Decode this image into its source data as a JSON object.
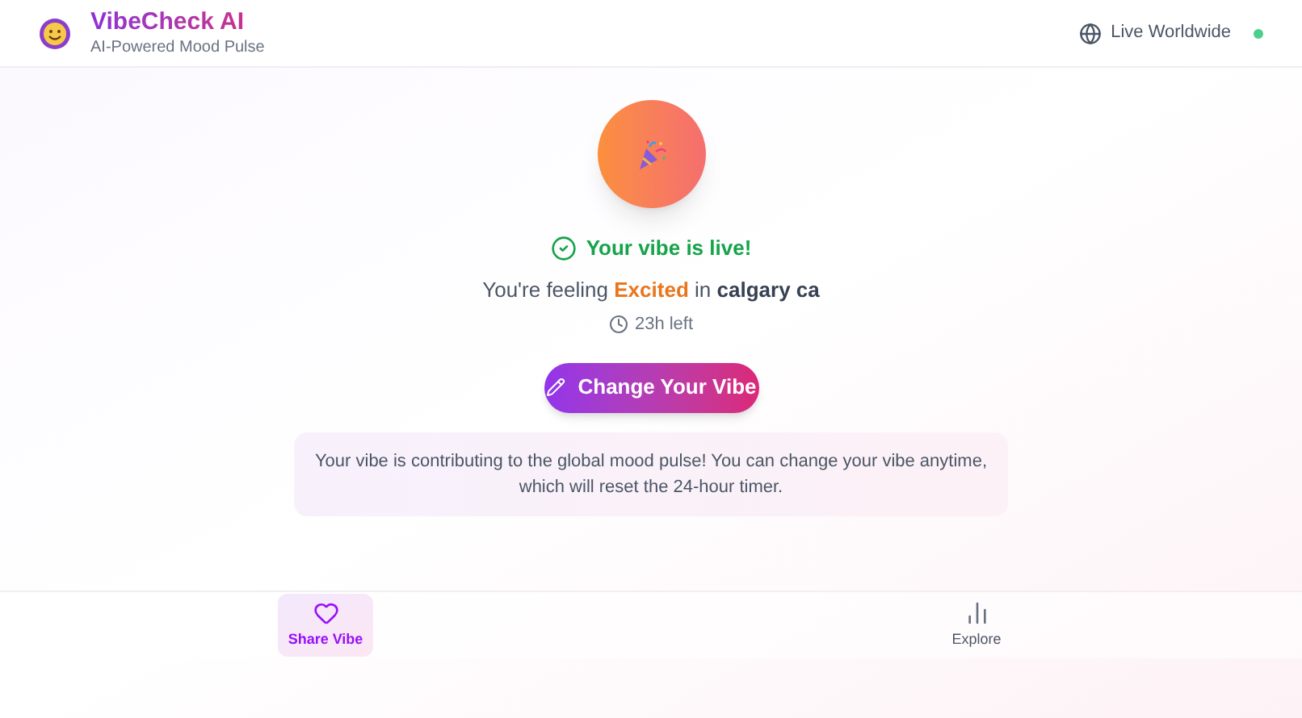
{
  "header": {
    "title": "VibeCheck AI",
    "subtitle": "AI-Powered Mood Pulse",
    "status": "Live Worldwide",
    "live": true
  },
  "vibe": {
    "status": "Your vibe is live!",
    "feeling_prefix": "You're feeling",
    "mood": "Excited",
    "feeling_mid": "in",
    "location": "calgary ca",
    "time_left": "23h left"
  },
  "change_button": "Change Your Vibe",
  "info": "Your vibe is contributing to the global mood pulse! You can change your vibe anytime, which will reset the 24-hour timer.",
  "nav": [
    {
      "kind": "heart",
      "label": "Share Vibe",
      "selected": true
    },
    {
      "kind": "chart",
      "label": "Explore",
      "selected": false
    }
  ]
}
